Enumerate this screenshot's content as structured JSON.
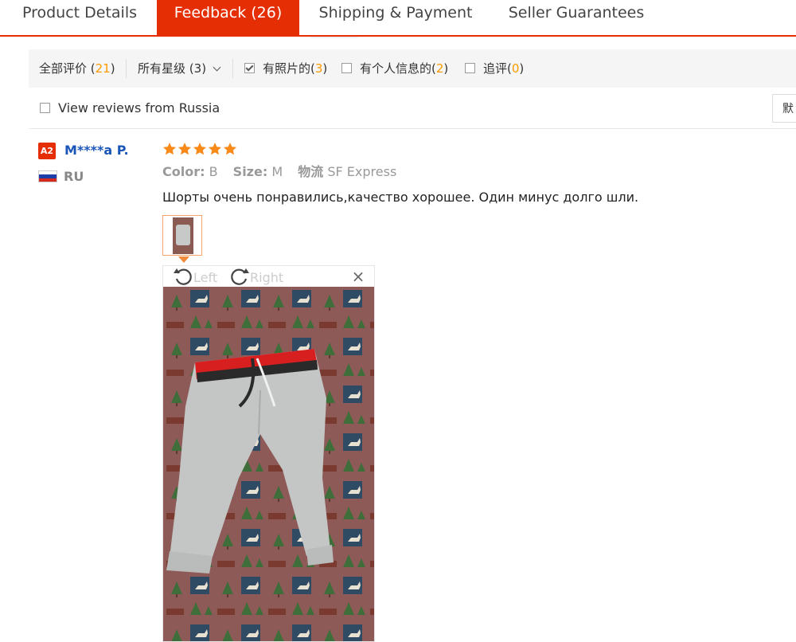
{
  "tabs": [
    {
      "label": "Product Details",
      "active": false
    },
    {
      "label": "Feedback (26)",
      "active": true
    },
    {
      "label": "Shipping & Payment",
      "active": false
    },
    {
      "label": "Seller Guarantees",
      "active": false
    }
  ],
  "filters": {
    "all_label": "全部评价",
    "all_count": "21",
    "stars_label": "所有星级",
    "stars_count": "(3)",
    "photos_label": "有照片的",
    "photos_count": "3",
    "personal_label": "有个人信息的",
    "personal_count": "2",
    "additional_label": "追评",
    "additional_count": "0"
  },
  "russia_label": "View reviews from Russia",
  "sort_label": "默",
  "review": {
    "level": "A2",
    "user": "M****a P.",
    "country": "RU",
    "rating": 5,
    "color_label": "Color:",
    "color_value": "B",
    "size_label": "Size:",
    "size_value": "M",
    "logistics_label": "物流",
    "logistics_value": "SF Express",
    "text": "Шорты очень понравились,качество хорошее. Один минус долго шли."
  },
  "viewer": {
    "left_label": "Left",
    "right_label": "Right",
    "close": "×"
  },
  "colors": {
    "accent": "#e62e04",
    "star": "#f98a1a",
    "count": "#ff9900",
    "link": "#1a55b8"
  },
  "icons": [
    "rotate-left-icon",
    "rotate-right-icon",
    "close-icon",
    "star-icon",
    "russia-flag-icon",
    "checkbox-icon",
    "chevron-down-icon"
  ]
}
